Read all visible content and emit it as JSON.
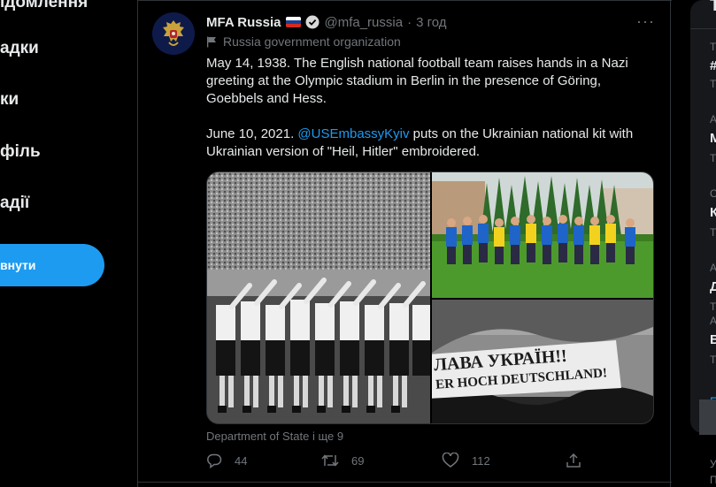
{
  "nav": {
    "items": [
      "ідомлення",
      "адки",
      "ки",
      "філь",
      "адії"
    ],
    "tweet_button": "внути"
  },
  "tweet": {
    "author_name": "MFA Russia",
    "flag": "russian-flag-emoji",
    "handle": "@mfa_russia",
    "separator": "·",
    "time": "3 год",
    "label": "Russia government organization",
    "more": "···",
    "text_line1": "May 14, 1938. The English national football team raises hands in a Nazi greeting at the Olympic stadium in Berlin in the presence of Göring, Goebbels and Hess.",
    "mention": "@USEmbassyKyiv",
    "text_line2": " puts on the Ukrainian national kit with Ukrainian version of \"Heil, Hitler\" embroidered.",
    "text_line2_prefix": "June 10, 2021. ",
    "banner_text_1": "ЛАВА УКРАЇН!!",
    "banner_text_2": "ER HOCH DEUTSCHLAND!",
    "source": "Department of State і ще 9",
    "replies": "44",
    "retweets": "69",
    "likes": "112"
  },
  "sidebar": {
    "title": "Т",
    "rows": [
      {
        "small": "Т",
        "bold": "#"
      },
      {
        "small": "Т",
        "bold": ""
      },
      {
        "small": "А",
        "bold": "М"
      },
      {
        "small": "Т",
        "bold": ""
      },
      {
        "small": "С",
        "bold": "К"
      },
      {
        "small": "Т",
        "bold": ""
      },
      {
        "small": "А",
        "bold": "Д"
      },
      {
        "small": "Т",
        "bold": ""
      },
      {
        "small": "А",
        "bold": "В"
      },
      {
        "small": "Т",
        "bold": ""
      }
    ],
    "link": "П",
    "footer1": "У",
    "footer2": "П"
  },
  "colors": {
    "accent": "#1d9bf0",
    "background": "#000000",
    "muted": "#71767b",
    "text": "#e7e9ea"
  }
}
